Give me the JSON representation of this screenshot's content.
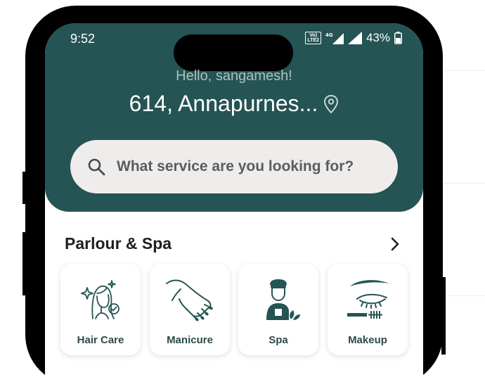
{
  "status_bar": {
    "time": "9:52",
    "volte": "Vo) LTE2",
    "network": "4G",
    "battery": "43%"
  },
  "header": {
    "greeting": "Hello, sangamesh!",
    "address": "614, Annapurnes..."
  },
  "search": {
    "placeholder": "What service are you looking for?"
  },
  "section": {
    "title": "Parlour & Spa",
    "categories": [
      {
        "label": "Hair Care",
        "icon": "hair-care-icon"
      },
      {
        "label": "Manicure",
        "icon": "manicure-icon"
      },
      {
        "label": "Spa",
        "icon": "spa-icon"
      },
      {
        "label": "Makeup",
        "icon": "makeup-icon"
      }
    ]
  },
  "colors": {
    "header": "#245453",
    "search_bg": "#efedec",
    "card_text": "#2b4a49"
  }
}
